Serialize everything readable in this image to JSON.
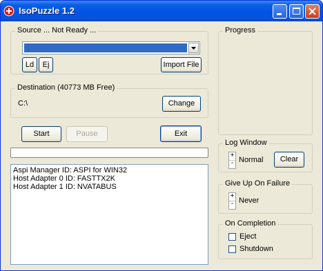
{
  "window": {
    "title": "IsoPuzzle 1.2"
  },
  "source": {
    "legend": "Source  ...  Not Ready  ...",
    "ld_label": "Ld",
    "ej_label": "Ej",
    "import_label": "Import File"
  },
  "destination": {
    "legend": "Destination  (40773 MB Free)",
    "path": "C:\\",
    "change_label": "Change"
  },
  "controls": {
    "start_label": "Start",
    "pause_label": "Pause",
    "exit_label": "Exit"
  },
  "log": {
    "lines": [
      "Aspi Manager ID: ASPI for WIN32",
      "Host Adapter 0 ID: FASTTX2K",
      "Host Adapter 1 ID: NVATABUS"
    ]
  },
  "progress": {
    "legend": "Progress"
  },
  "log_window": {
    "legend": "Log Window",
    "value": "Normal",
    "clear_label": "Clear",
    "spin_up": "+",
    "spin_down": "-"
  },
  "give_up": {
    "legend": "Give Up On Failure",
    "value": "Never",
    "spin_up": "+",
    "spin_down": "-"
  },
  "completion": {
    "legend": "On Completion",
    "eject_label": "Eject",
    "shutdown_label": "Shutdown",
    "eject_checked": false,
    "shutdown_checked": false
  }
}
